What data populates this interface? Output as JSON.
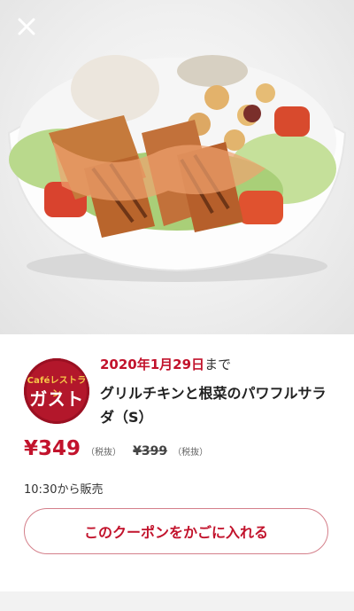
{
  "header": {
    "close_icon": "close-icon"
  },
  "photo": {
    "icon": "salad-photo"
  },
  "brand": {
    "logo_top": "Caféレストラン",
    "logo_main": "ガスト",
    "accent": "#b3172b"
  },
  "coupon": {
    "deadline_date": "2020年1月29日",
    "deadline_suffix": "まで",
    "title": "グリルチキンと根菜のパワフルサラダ（S）",
    "price": "¥349",
    "price_tax": "（税抜）",
    "old_price": "¥399",
    "old_price_tax": "（税抜）",
    "sale_time": "10:30から販売",
    "cart_button": "このクーポンをかごに入れる"
  },
  "colors": {
    "price_red": "#c2132c",
    "button_border": "#d47f8a"
  }
}
